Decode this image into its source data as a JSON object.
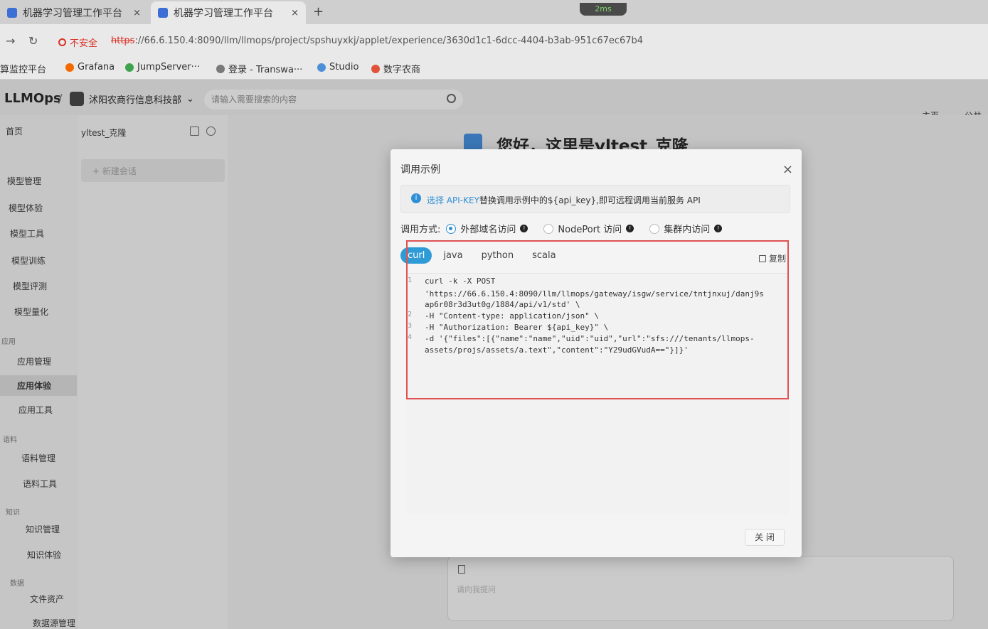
{
  "browser": {
    "tabs": [
      {
        "title": "机器学习管理工作平台"
      },
      {
        "title": "机器学习管理工作平台"
      }
    ],
    "new_tab": "+",
    "close_icon": "×",
    "net_badge": "2ms",
    "security_label": "不安全",
    "url_scheme": "https",
    "url_rest": "://66.6.150.4:8090/llm/llmops/project/spshuyxkj/applet/experience/3630d1c1-6dcc-4404-b3ab-951c67ec67b4",
    "bookmarks": [
      {
        "label": "算监控平台",
        "color": "#999999"
      },
      {
        "label": "Grafana",
        "color": "#f46800"
      },
      {
        "label": "JumpServer···",
        "color": "#3fa34d"
      },
      {
        "label": "登录 - Transwa···",
        "color": "#7a7a7a"
      },
      {
        "label": "Studio",
        "color": "#4d8fd6"
      },
      {
        "label": "数字农商",
        "color": "#e0533a"
      }
    ]
  },
  "app": {
    "logo": "LLMOps",
    "separator": "/",
    "org_name": "沭阳农商行信息科技部",
    "search_placeholder": "请输入需要搜索的内容",
    "top_right": [
      "主页",
      "公共"
    ]
  },
  "sidebar": {
    "home": "首页",
    "sections": [
      "应用",
      "语料",
      "知识",
      "数据"
    ],
    "items": [
      {
        "label": "模型管理"
      },
      {
        "label": "模型体验"
      },
      {
        "label": "模型工具"
      },
      {
        "label": "模型训练"
      },
      {
        "label": "模型评测"
      },
      {
        "label": "模型量化"
      },
      {
        "label": "应用管理"
      },
      {
        "label": "应用体验"
      },
      {
        "label": "应用工具"
      },
      {
        "label": "语料管理"
      },
      {
        "label": "语料工具"
      },
      {
        "label": "知识管理"
      },
      {
        "label": "知识体验"
      },
      {
        "label": "文件资产"
      },
      {
        "label": "数据源管理"
      }
    ]
  },
  "chatlist": {
    "current": "yltest_克隆",
    "new_chat": "+ 新建会话"
  },
  "main": {
    "greeting": "您好，这里是yltest_克隆",
    "input_placeholder": "请向我提问"
  },
  "modal": {
    "title": "调用示例",
    "close_icon": "×",
    "info_link": "选择 API-KEY",
    "info_text": "替换调用示例中的${api_key},即可远程调用当前服务 API",
    "method_label": "调用方式:",
    "methods": [
      {
        "label": "外部域名访问",
        "checked": true
      },
      {
        "label": "NodePort 访问",
        "checked": false
      },
      {
        "label": "集群内访问",
        "checked": false
      }
    ],
    "lang_tabs": [
      "curl",
      "java",
      "python",
      "scala"
    ],
    "active_lang": "curl",
    "copy_label": "复制",
    "code_lines": [
      {
        "num": "1",
        "text": "curl -k -X POST"
      },
      {
        "num": "",
        "text": "'https://66.6.150.4:8090/llm/llmops/gateway/isgw/service/tntjnxuj/danj9s"
      },
      {
        "num": "",
        "text": "ap6r08r3d3ut0g/1884/api/v1/std' \\"
      },
      {
        "num": "2",
        "text": "-H \"Content-type: application/json\" \\"
      },
      {
        "num": "3",
        "text": "-H \"Authorization: Bearer ${api_key}\" \\"
      },
      {
        "num": "4",
        "text": "-d '{\"files\":[{\"name\":\"name\",\"uid\":\"uid\",\"url\":\"sfs:///tenants/llmops-"
      },
      {
        "num": "",
        "text": "assets/projs/assets/a.text\",\"content\":\"Y29udGVudA==\"}]}'"
      }
    ],
    "close_button": "关 闭"
  }
}
